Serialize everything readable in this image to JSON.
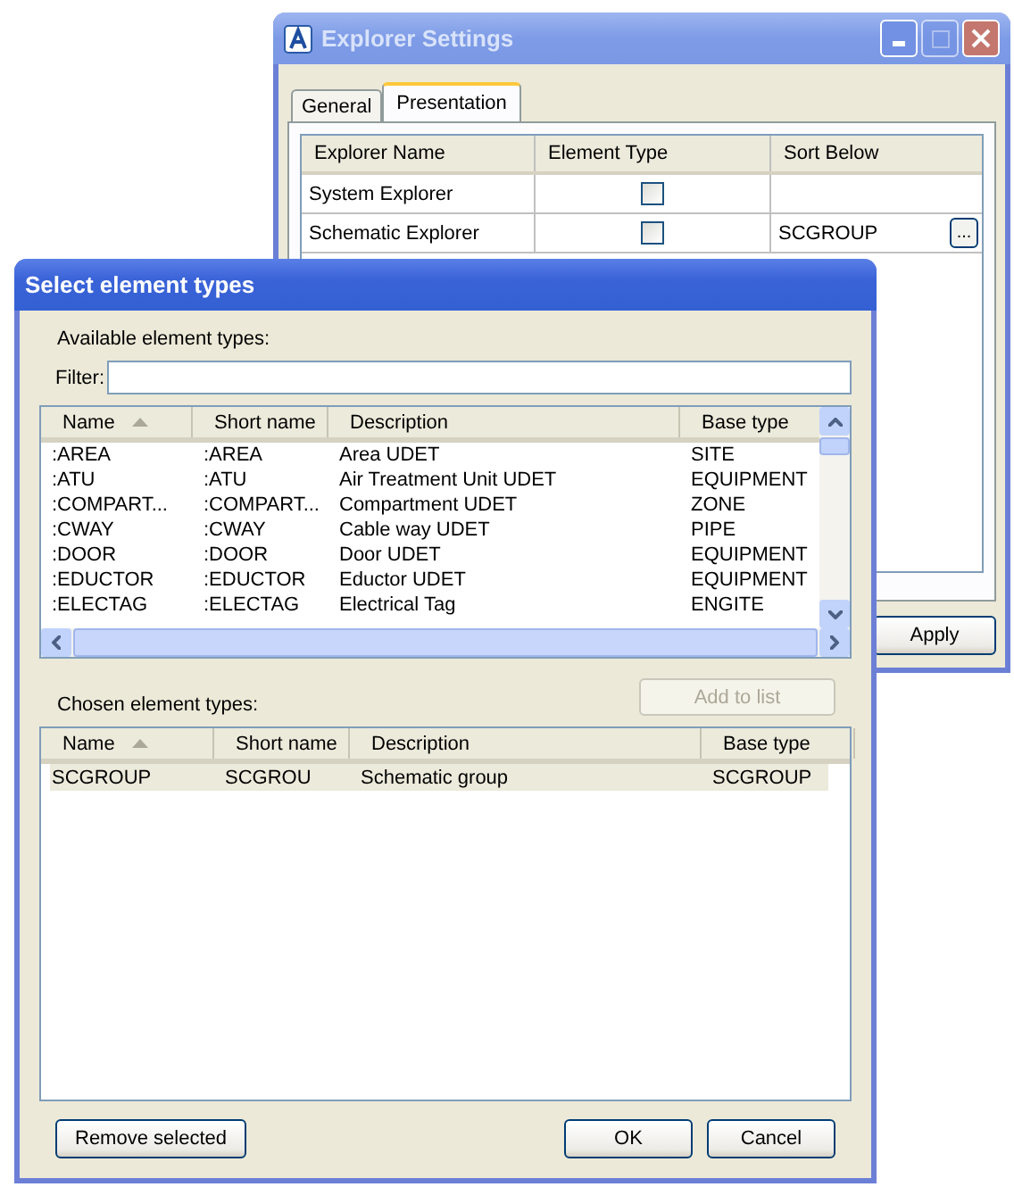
{
  "explorer_settings": {
    "title": "Explorer Settings",
    "active": false,
    "tabs": [
      {
        "label": "General",
        "selected": false
      },
      {
        "label": "Presentation",
        "selected": true
      }
    ],
    "table": {
      "columns": [
        "Explorer Name",
        "Element Type",
        "Sort Below"
      ],
      "rows": [
        {
          "explorer_name": "System Explorer",
          "element_type": false,
          "sort_below": ""
        },
        {
          "explorer_name": "Schematic Explorer",
          "element_type": false,
          "sort_below": "SCGROUP",
          "browse_button": "..."
        }
      ]
    },
    "apply_button": "Apply"
  },
  "select_dialog": {
    "title": "Select element types",
    "active": true,
    "available_label": "Available element types:",
    "filter_label": "Filter:",
    "available": {
      "columns": [
        {
          "label": "Name",
          "sorted": true
        },
        {
          "label": "Short name",
          "sorted": false
        },
        {
          "label": "Description",
          "sorted": false
        },
        {
          "label": "Base type",
          "sorted": false
        }
      ],
      "rows": [
        {
          "cells": [
            ":AREA",
            ":AREA",
            "Area UDET",
            "SITE"
          ],
          "selected": false
        },
        {
          "cells": [
            ":ATU",
            ":ATU",
            "Air Treatment Unit UDET",
            "EQUIPMENT"
          ],
          "selected": false
        },
        {
          "cells": [
            ":COMPART...",
            ":COMPART...",
            "Compartment UDET",
            "ZONE"
          ],
          "selected": false
        },
        {
          "cells": [
            ":CWAY",
            ":CWAY",
            "Cable way UDET",
            "PIPE"
          ],
          "selected": false
        },
        {
          "cells": [
            ":DOOR",
            ":DOOR",
            "Door UDET",
            "EQUIPMENT"
          ],
          "selected": false
        },
        {
          "cells": [
            ":EDUCTOR",
            ":EDUCTOR",
            "Eductor UDET",
            "EQUIPMENT"
          ],
          "selected": false
        },
        {
          "cells": [
            ":ELECTAG",
            ":ELECTAG",
            "Electrical Tag",
            "ENGITE"
          ],
          "selected": false
        }
      ]
    },
    "add_button": {
      "label": "Add to list",
      "disabled": true
    },
    "chosen_label": "Chosen element types:",
    "chosen": {
      "columns": [
        {
          "label": "Name",
          "sorted": true
        },
        {
          "label": "Short name",
          "sorted": false
        },
        {
          "label": "Description",
          "sorted": false
        },
        {
          "label": "Base type",
          "sorted": false
        }
      ],
      "rows": [
        {
          "cells": [
            "SCGROUP",
            "SCGROU",
            "Schematic group",
            "SCGROUP"
          ],
          "selected": true
        }
      ]
    },
    "remove_button": "Remove selected",
    "ok_button": "OK",
    "cancel_button": "Cancel"
  }
}
